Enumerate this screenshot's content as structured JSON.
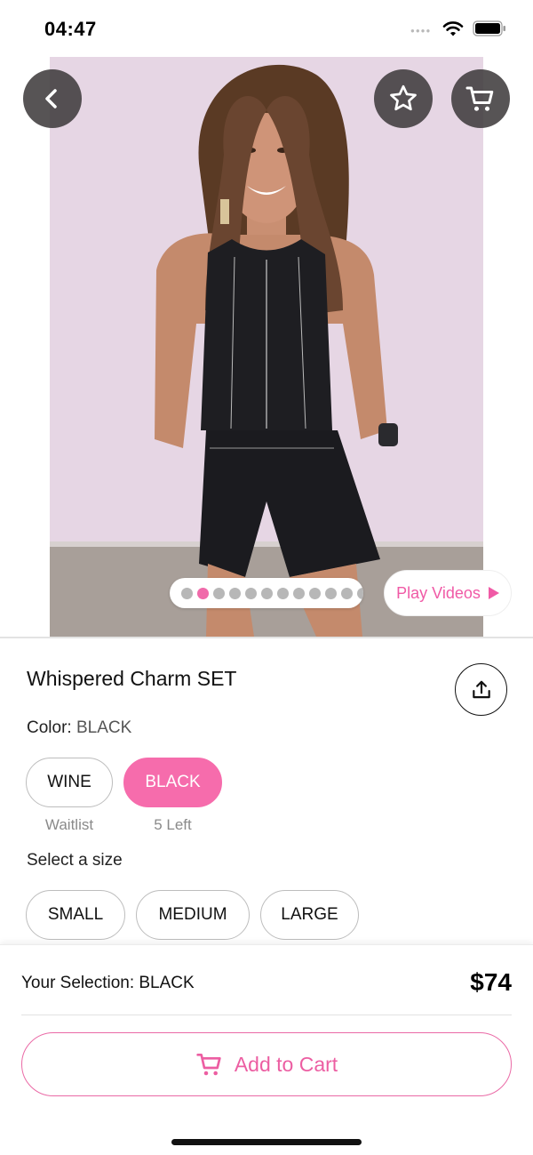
{
  "status_bar": {
    "time": "04:47"
  },
  "icons": {
    "back": "chevron-left-icon",
    "favorite": "star-outline-icon",
    "cart": "cart-icon",
    "share": "share-icon",
    "play": "play-triangle-icon",
    "add_to_cart": "cart-icon"
  },
  "gallery": {
    "page_count": 12,
    "active_index": 1,
    "play_videos_label": "Play Videos"
  },
  "product": {
    "title": "Whispered Charm SET",
    "color_label": "Color:",
    "color_value": "BLACK"
  },
  "colors": [
    {
      "name": "WINE",
      "stock": "Waitlist",
      "selected": false
    },
    {
      "name": "BLACK",
      "stock": "5 Left",
      "selected": true
    }
  ],
  "sizes": {
    "heading": "Select a size",
    "options": [
      "SMALL",
      "MEDIUM",
      "LARGE"
    ]
  },
  "bottom": {
    "selection_text": "Your Selection: BLACK",
    "price": "$74",
    "add_to_cart_label": "Add to Cart"
  },
  "theme": {
    "accent": "#f66cac",
    "accent_text": "#ec5ea2",
    "inactive_dot": "#b7b7b7",
    "overlay_button": "#403c3e"
  }
}
